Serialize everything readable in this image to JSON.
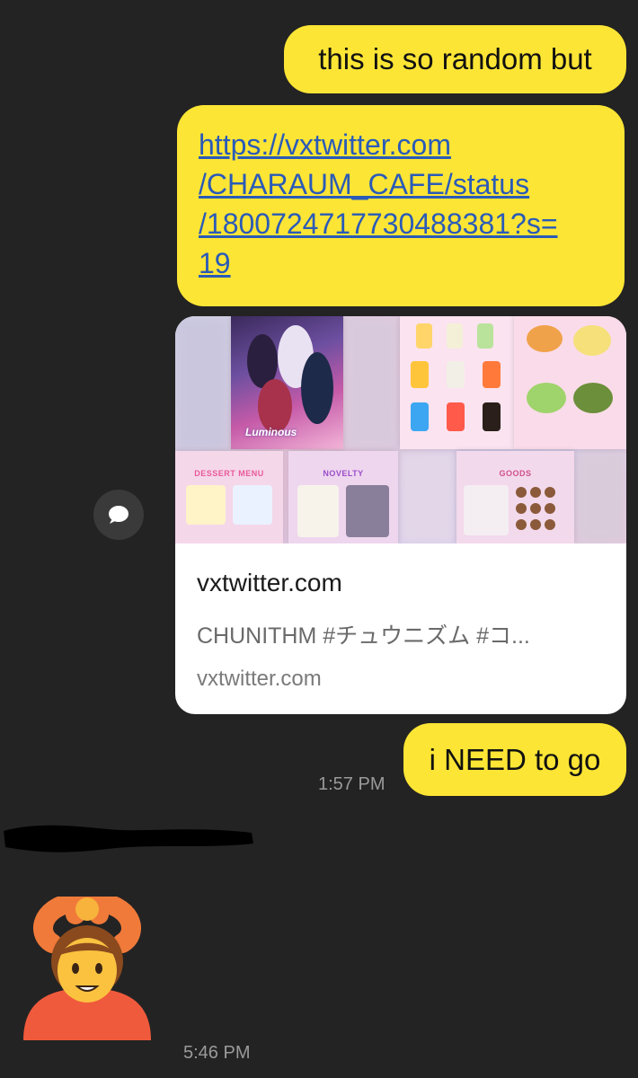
{
  "messages": {
    "m1": "this is so random but",
    "link": {
      "url_line1": "https://vxtwitter.com",
      "url_line2": "/CHARAUM_CAFE/status",
      "url_line3": "/1800724717730488381?s=",
      "url_line4": "19"
    },
    "preview": {
      "title": "vxtwitter.com",
      "description": "CHUNITHM #チュウニズム #コ...",
      "domain": "vxtwitter.com",
      "panels": {
        "poster_label": "Luminous",
        "dessert_label": "DESSERT MENU",
        "novelty_label": "NOVELTY",
        "goods_label": "GOODS"
      }
    },
    "m3": "i NEED to go",
    "time_sent": "1:57 PM",
    "time_received": "5:46 PM"
  },
  "icons": {
    "reply": "speech-bubble-icon",
    "emoji": "person-gesturing-ok-emoji"
  },
  "colors": {
    "background": "#232323",
    "sent_bubble": "#fde535",
    "link_text": "#2a5bb8",
    "timestamp": "#9a9a9a"
  }
}
